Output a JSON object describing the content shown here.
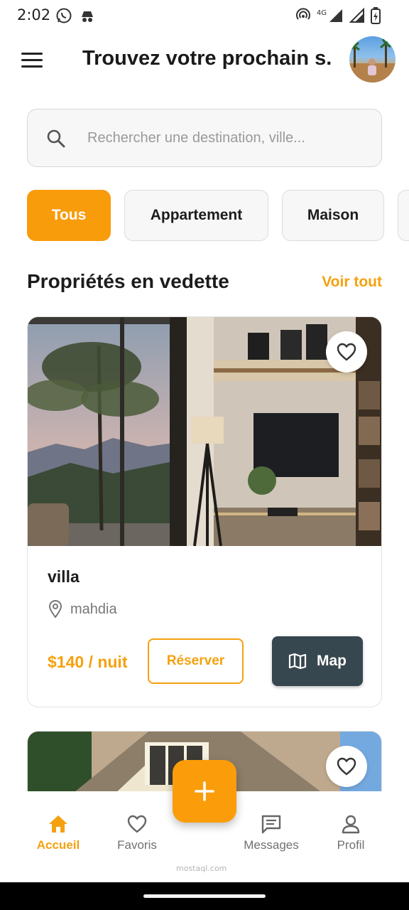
{
  "status_bar": {
    "time": "2:02",
    "network": "4G"
  },
  "app_bar": {
    "title": "Trouvez votre prochain s..."
  },
  "search": {
    "placeholder": "Rechercher une destination, ville..."
  },
  "filters": [
    {
      "label": "Tous",
      "active": true
    },
    {
      "label": "Appartement",
      "active": false
    },
    {
      "label": "Maison",
      "active": false
    }
  ],
  "featured": {
    "title": "Propriétés en vedette",
    "see_all": "Voir tout"
  },
  "property": {
    "name": "villa",
    "location": "mahdia",
    "price": "$140 / nuit",
    "reserve_label": "Réserver",
    "map_label": "Map"
  },
  "nav": {
    "home": "Accueil",
    "favorites": "Favoris",
    "messages": "Messages",
    "profile": "Profil"
  },
  "watermark": "mostaql.com",
  "colors": {
    "accent": "#f99c0c",
    "map_button": "#37474f"
  },
  "icons": [
    "menu-icon",
    "search-icon",
    "heart-icon",
    "location-pin-icon",
    "map-icon",
    "plus-icon",
    "home-icon",
    "message-icon",
    "person-icon"
  ]
}
